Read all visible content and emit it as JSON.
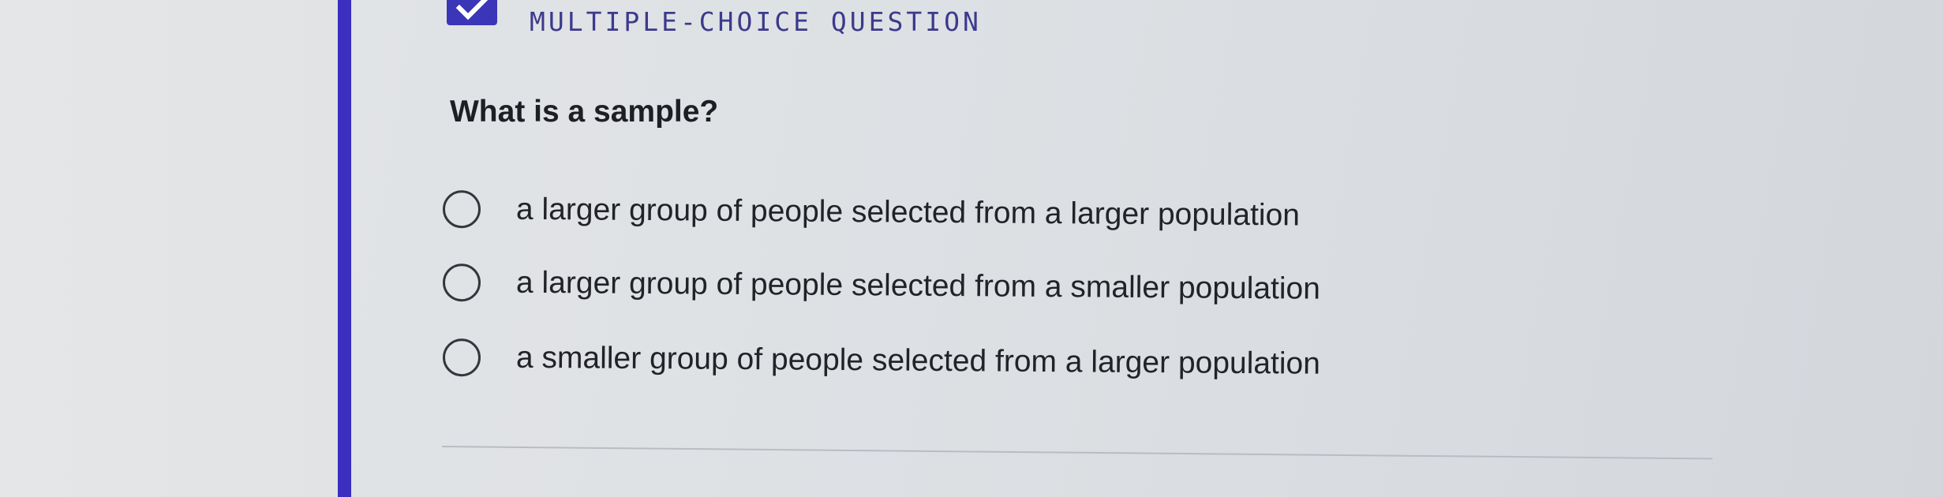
{
  "question": {
    "type_label": "MULTIPLE-CHOICE QUESTION",
    "type_icon": "checkbox-checked-icon",
    "prompt": "What is a sample?",
    "choices": [
      {
        "label": "a larger group of people selected from a larger population",
        "selected": false
      },
      {
        "label": "a larger group of people selected from a smaller population",
        "selected": false
      },
      {
        "label": "a smaller group of people selected from a larger population",
        "selected": false
      }
    ]
  },
  "colors": {
    "accent": "#3a2fbf",
    "type_label": "#3c3a8c",
    "text": "#1e1f24"
  }
}
